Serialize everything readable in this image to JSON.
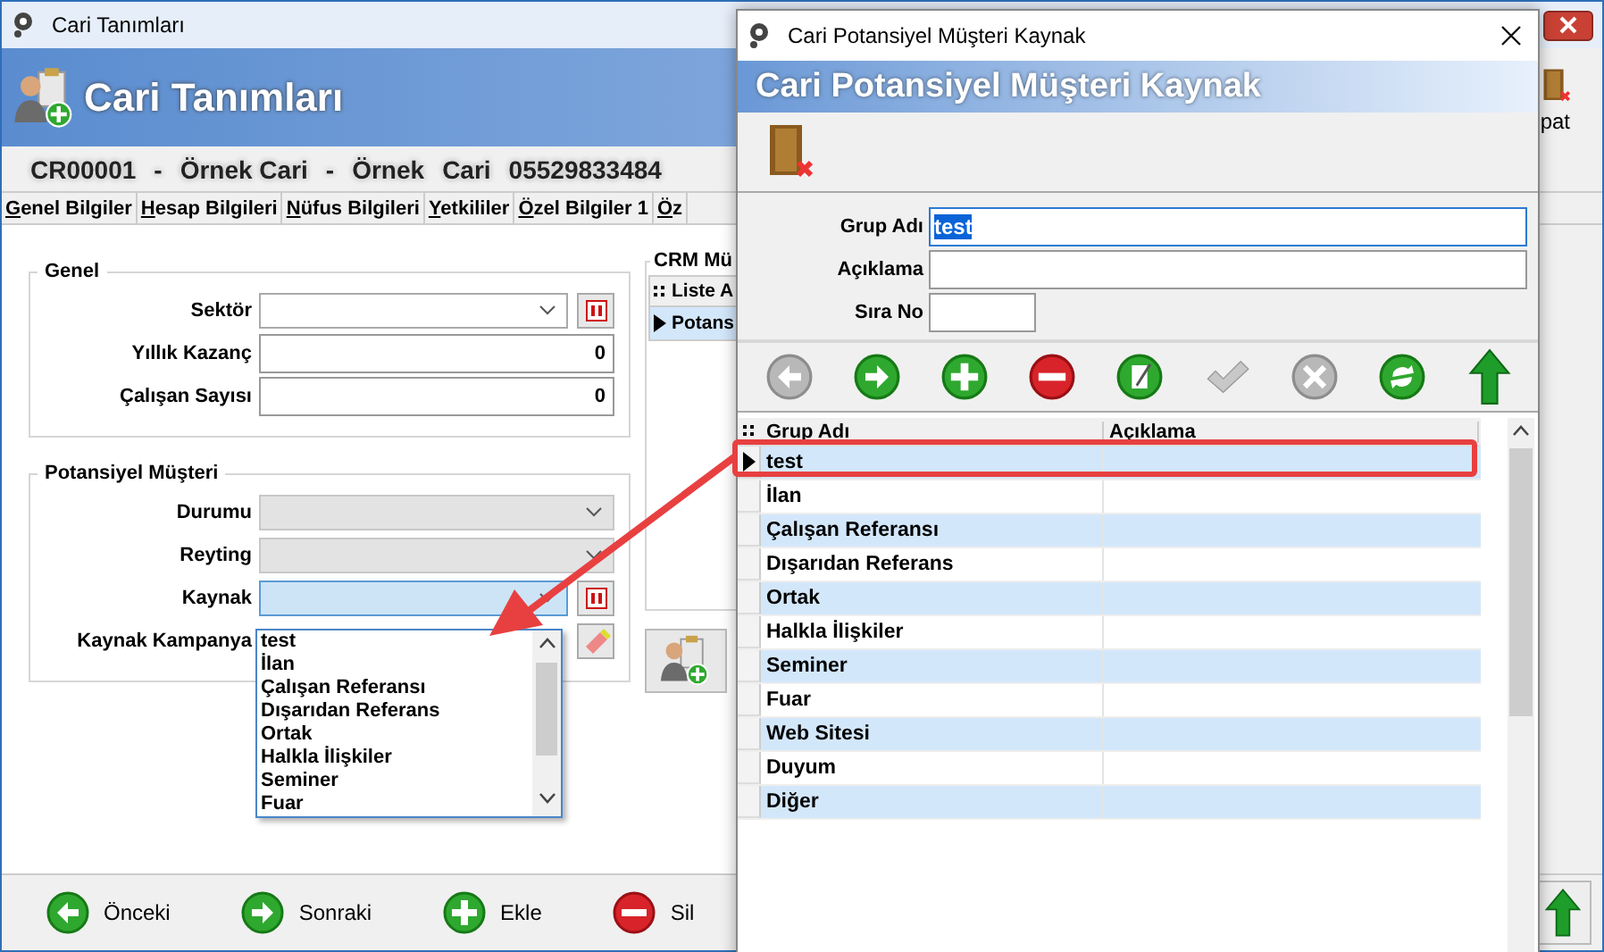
{
  "main_window": {
    "title": "Cari Tanımları",
    "header": "Cari Tanımları",
    "toolbar_label": "pat",
    "record": [
      "CR00001",
      "-",
      "Örnek Cari",
      "-",
      "Örnek",
      "Cari",
      "05529833484"
    ],
    "tabs": [
      {
        "label": "Genel Bilgiler"
      },
      {
        "label": "Hesap Bilgileri"
      },
      {
        "label": "Nüfus Bilgileri"
      },
      {
        "label": "Yetkililer"
      },
      {
        "label": "Özel Bilgiler 1"
      },
      {
        "label": "Öz"
      }
    ],
    "genel": {
      "title": "Genel",
      "fields": [
        {
          "label": "Sektör",
          "kind": "combo",
          "disabled": false,
          "focused": false,
          "side_button": {
            "kind": "lookup"
          }
        },
        {
          "label": "Yıllık Kazanç",
          "kind": "number",
          "value": "0"
        },
        {
          "label": "Çalışan Sayısı",
          "kind": "number",
          "value": "0"
        }
      ]
    },
    "potansiyel": {
      "title": "Potansiyel Müşteri",
      "fields": [
        {
          "label": "Durumu",
          "kind": "combo",
          "disabled": true,
          "focused": false
        },
        {
          "label": "Reyting",
          "kind": "combo",
          "disabled": true,
          "focused": false
        },
        {
          "label": "Kaynak",
          "kind": "combo",
          "disabled": false,
          "focused": true,
          "side_button": {
            "kind": "lookup"
          }
        },
        {
          "label": "Kaynak Kampanya",
          "kind": "hidden",
          "side_button": {
            "kind": "eraser"
          }
        }
      ]
    },
    "dropdown": {
      "items": [
        "test",
        "İlan",
        "Çalışan Referansı",
        "Dışarıdan Referans",
        "Ortak",
        "Halkla İlişkiler",
        "Seminer",
        "Fuar"
      ]
    },
    "crm": {
      "title": "CRM Mü",
      "columns": [
        "Liste A"
      ],
      "rows": [
        {
          "cells": [
            "Potans"
          ],
          "selected": true
        }
      ]
    },
    "buttons": [
      {
        "label": "Önceki",
        "kind": "prev"
      },
      {
        "label": "Sonraki",
        "kind": "next"
      },
      {
        "label": "Ekle",
        "kind": "add"
      },
      {
        "label": "Sil",
        "kind": "delete"
      }
    ]
  },
  "dialog": {
    "title": "Cari Potansiyel Müşteri Kaynak",
    "header": "Cari Potansiyel Müşteri Kaynak",
    "fields": [
      {
        "label": "Grup Adı",
        "value": "test",
        "kind": "wide",
        "focused": true
      },
      {
        "label": "Açıklama",
        "kind": "wide",
        "focused": false
      },
      {
        "label": "Sıra No",
        "kind": "short",
        "focused": false
      }
    ],
    "nav": [
      {
        "kind": "prev",
        "disabled": true
      },
      {
        "kind": "next",
        "disabled": false
      },
      {
        "kind": "add",
        "disabled": false
      },
      {
        "kind": "delete",
        "disabled": false
      },
      {
        "kind": "edit",
        "disabled": false
      },
      {
        "kind": "check",
        "disabled": true
      },
      {
        "kind": "cancel",
        "disabled": true
      },
      {
        "kind": "refresh",
        "disabled": false
      },
      {
        "kind": "up",
        "disabled": false
      }
    ],
    "columns": [
      "Grup Adı",
      "Açıklama"
    ],
    "rows": [
      {
        "name": "test",
        "selected": true
      },
      {
        "name": "İlan",
        "selected": false
      },
      {
        "name": "Çalışan Referansı",
        "selected": false
      },
      {
        "name": "Dışarıdan Referans",
        "selected": false
      },
      {
        "name": "Ortak",
        "selected": false
      },
      {
        "name": "Halkla İlişkiler",
        "selected": false
      },
      {
        "name": "Seminer",
        "selected": false
      },
      {
        "name": "Fuar",
        "selected": false
      },
      {
        "name": "Web Sitesi",
        "selected": false
      },
      {
        "name": "Duyum",
        "selected": false
      },
      {
        "name": "Diğer",
        "selected": false
      }
    ]
  }
}
